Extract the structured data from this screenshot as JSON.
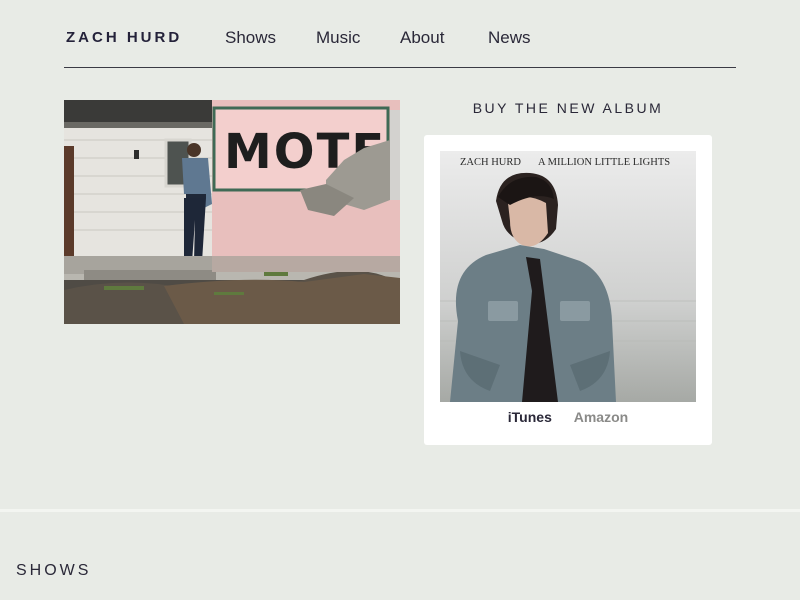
{
  "header": {
    "brand": "ZACH HURD",
    "nav": [
      {
        "label": "Shows"
      },
      {
        "label": "Music"
      },
      {
        "label": "About"
      },
      {
        "label": "News"
      }
    ]
  },
  "hero": {
    "sign_text": "MOTEL"
  },
  "album": {
    "heading": "BUY THE NEW ALBUM",
    "cover_artist": "ZACH HURD",
    "cover_title": "A MILLION LITTLE LIGHTS",
    "links": {
      "itunes": "iTunes",
      "amazon": "Amazon"
    }
  },
  "shows": {
    "heading": "SHOWS"
  },
  "colors": {
    "background": "#e8ebe6",
    "text": "#24223a",
    "muted_link": "#8a8a88",
    "card": "#ffffff"
  }
}
